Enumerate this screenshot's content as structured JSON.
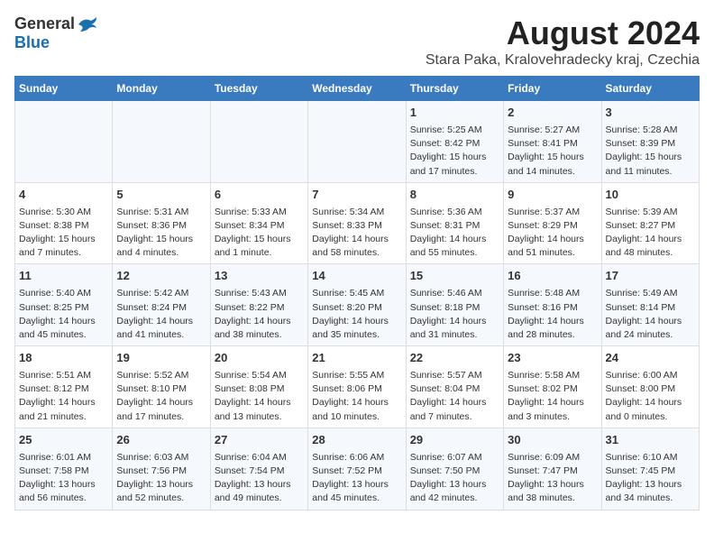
{
  "logo": {
    "general": "General",
    "blue": "Blue"
  },
  "title": "August 2024",
  "subtitle": "Stara Paka, Kralovehradecky kraj, Czechia",
  "weekdays": [
    "Sunday",
    "Monday",
    "Tuesday",
    "Wednesday",
    "Thursday",
    "Friday",
    "Saturday"
  ],
  "weeks": [
    [
      {
        "day": "",
        "content": ""
      },
      {
        "day": "",
        "content": ""
      },
      {
        "day": "",
        "content": ""
      },
      {
        "day": "",
        "content": ""
      },
      {
        "day": "1",
        "content": "Sunrise: 5:25 AM\nSunset: 8:42 PM\nDaylight: 15 hours\nand 17 minutes."
      },
      {
        "day": "2",
        "content": "Sunrise: 5:27 AM\nSunset: 8:41 PM\nDaylight: 15 hours\nand 14 minutes."
      },
      {
        "day": "3",
        "content": "Sunrise: 5:28 AM\nSunset: 8:39 PM\nDaylight: 15 hours\nand 11 minutes."
      }
    ],
    [
      {
        "day": "4",
        "content": "Sunrise: 5:30 AM\nSunset: 8:38 PM\nDaylight: 15 hours\nand 7 minutes."
      },
      {
        "day": "5",
        "content": "Sunrise: 5:31 AM\nSunset: 8:36 PM\nDaylight: 15 hours\nand 4 minutes."
      },
      {
        "day": "6",
        "content": "Sunrise: 5:33 AM\nSunset: 8:34 PM\nDaylight: 15 hours\nand 1 minute."
      },
      {
        "day": "7",
        "content": "Sunrise: 5:34 AM\nSunset: 8:33 PM\nDaylight: 14 hours\nand 58 minutes."
      },
      {
        "day": "8",
        "content": "Sunrise: 5:36 AM\nSunset: 8:31 PM\nDaylight: 14 hours\nand 55 minutes."
      },
      {
        "day": "9",
        "content": "Sunrise: 5:37 AM\nSunset: 8:29 PM\nDaylight: 14 hours\nand 51 minutes."
      },
      {
        "day": "10",
        "content": "Sunrise: 5:39 AM\nSunset: 8:27 PM\nDaylight: 14 hours\nand 48 minutes."
      }
    ],
    [
      {
        "day": "11",
        "content": "Sunrise: 5:40 AM\nSunset: 8:25 PM\nDaylight: 14 hours\nand 45 minutes."
      },
      {
        "day": "12",
        "content": "Sunrise: 5:42 AM\nSunset: 8:24 PM\nDaylight: 14 hours\nand 41 minutes."
      },
      {
        "day": "13",
        "content": "Sunrise: 5:43 AM\nSunset: 8:22 PM\nDaylight: 14 hours\nand 38 minutes."
      },
      {
        "day": "14",
        "content": "Sunrise: 5:45 AM\nSunset: 8:20 PM\nDaylight: 14 hours\nand 35 minutes."
      },
      {
        "day": "15",
        "content": "Sunrise: 5:46 AM\nSunset: 8:18 PM\nDaylight: 14 hours\nand 31 minutes."
      },
      {
        "day": "16",
        "content": "Sunrise: 5:48 AM\nSunset: 8:16 PM\nDaylight: 14 hours\nand 28 minutes."
      },
      {
        "day": "17",
        "content": "Sunrise: 5:49 AM\nSunset: 8:14 PM\nDaylight: 14 hours\nand 24 minutes."
      }
    ],
    [
      {
        "day": "18",
        "content": "Sunrise: 5:51 AM\nSunset: 8:12 PM\nDaylight: 14 hours\nand 21 minutes."
      },
      {
        "day": "19",
        "content": "Sunrise: 5:52 AM\nSunset: 8:10 PM\nDaylight: 14 hours\nand 17 minutes."
      },
      {
        "day": "20",
        "content": "Sunrise: 5:54 AM\nSunset: 8:08 PM\nDaylight: 14 hours\nand 13 minutes."
      },
      {
        "day": "21",
        "content": "Sunrise: 5:55 AM\nSunset: 8:06 PM\nDaylight: 14 hours\nand 10 minutes."
      },
      {
        "day": "22",
        "content": "Sunrise: 5:57 AM\nSunset: 8:04 PM\nDaylight: 14 hours\nand 7 minutes."
      },
      {
        "day": "23",
        "content": "Sunrise: 5:58 AM\nSunset: 8:02 PM\nDaylight: 14 hours\nand 3 minutes."
      },
      {
        "day": "24",
        "content": "Sunrise: 6:00 AM\nSunset: 8:00 PM\nDaylight: 14 hours\nand 0 minutes."
      }
    ],
    [
      {
        "day": "25",
        "content": "Sunrise: 6:01 AM\nSunset: 7:58 PM\nDaylight: 13 hours\nand 56 minutes."
      },
      {
        "day": "26",
        "content": "Sunrise: 6:03 AM\nSunset: 7:56 PM\nDaylight: 13 hours\nand 52 minutes."
      },
      {
        "day": "27",
        "content": "Sunrise: 6:04 AM\nSunset: 7:54 PM\nDaylight: 13 hours\nand 49 minutes."
      },
      {
        "day": "28",
        "content": "Sunrise: 6:06 AM\nSunset: 7:52 PM\nDaylight: 13 hours\nand 45 minutes."
      },
      {
        "day": "29",
        "content": "Sunrise: 6:07 AM\nSunset: 7:50 PM\nDaylight: 13 hours\nand 42 minutes."
      },
      {
        "day": "30",
        "content": "Sunrise: 6:09 AM\nSunset: 7:47 PM\nDaylight: 13 hours\nand 38 minutes."
      },
      {
        "day": "31",
        "content": "Sunrise: 6:10 AM\nSunset: 7:45 PM\nDaylight: 13 hours\nand 34 minutes."
      }
    ]
  ]
}
